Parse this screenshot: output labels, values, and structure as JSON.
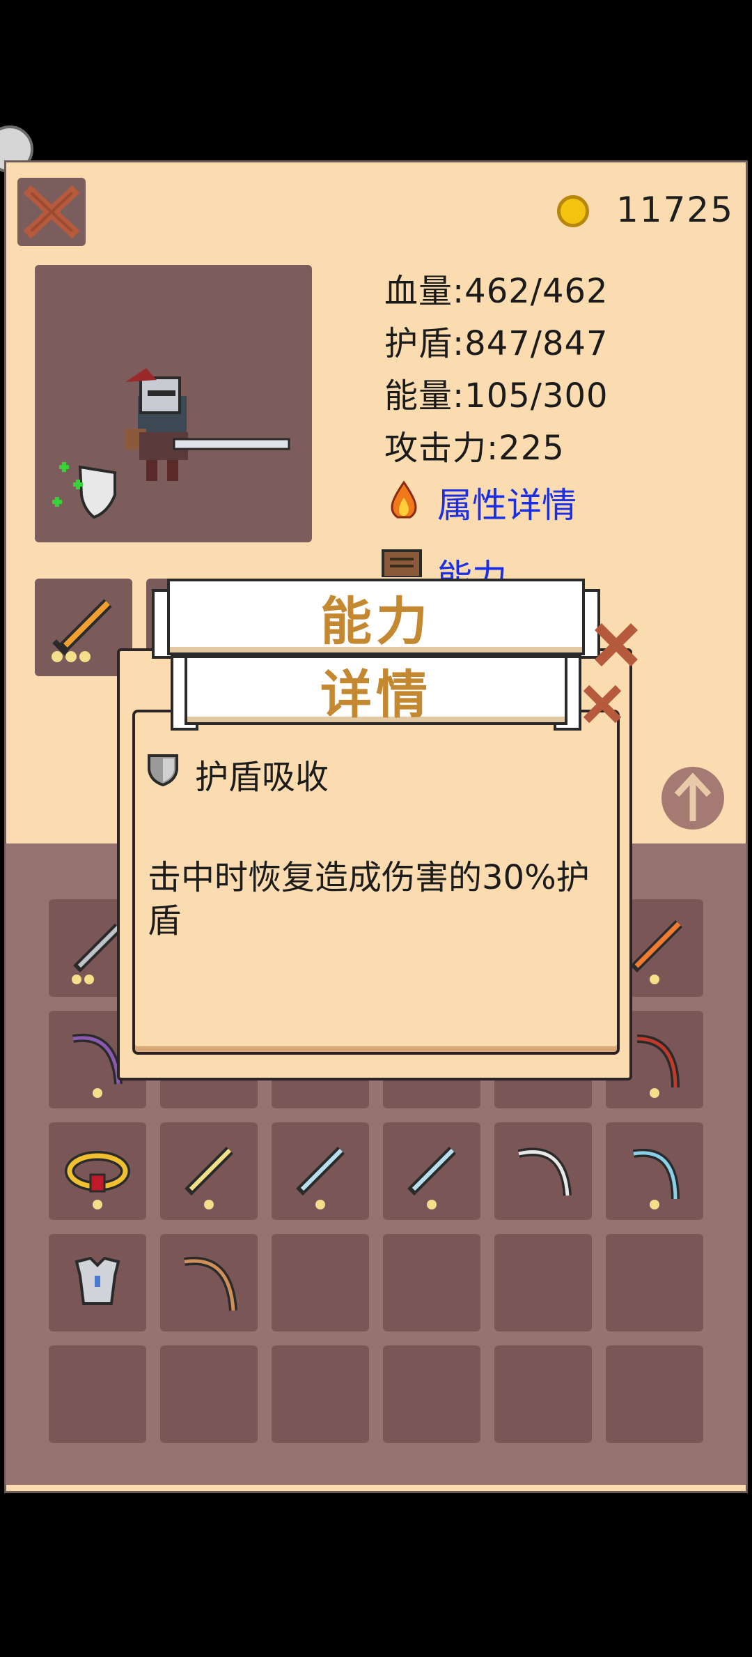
{
  "header": {
    "coins": "11725"
  },
  "stats": {
    "hp": "血量:462/462",
    "shield": "护盾:847/847",
    "energy": "能量:105/300",
    "attack": "攻击力:225"
  },
  "links": {
    "attributes": "属性详情",
    "abilities": "能力"
  },
  "modal_back": {
    "title": "能力"
  },
  "modal_front": {
    "title": "详情",
    "ability_name": "护盾吸收",
    "description": "击中时恢复造成伤害的30%护盾"
  },
  "icons": {
    "close": "close-x-icon",
    "coin": "gold-coin-icon",
    "fire": "fire-icon",
    "book": "book-icon",
    "shield": "shield-icon",
    "up": "up-arrow-icon"
  },
  "colors": {
    "panel_bg": "#fbdcb1",
    "slot_bg": "#7a5656",
    "banner_text": "#c48830",
    "link_text": "#1a2ee6",
    "close_x": "#b55a3c"
  }
}
